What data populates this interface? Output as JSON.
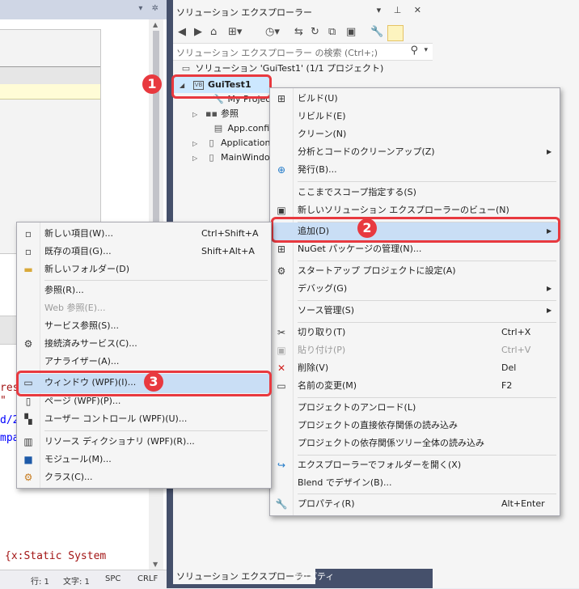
{
  "editor": {
    "code_lines": [
      "res",
      "\"",
      "d/2",
      "mpa",
      "{x:Static System"
    ],
    "status": {
      "line": "行: 1",
      "col": "文字: 1",
      "spc": "SPC",
      "crlf": "CRLF"
    }
  },
  "solution_explorer": {
    "title": "ソリューション エクスプローラー",
    "search_placeholder": "ソリューション エクスプローラー の検索 (Ctrl+;)",
    "tree": {
      "solution": "ソリューション 'GuiTest1' (1/1 プロジェクト)",
      "project": "GuiTest1",
      "project_badge": "VB",
      "items": [
        "My Project",
        "参照",
        "App.config",
        "Application.xaml",
        "MainWindow.xaml"
      ]
    },
    "tabs": {
      "explorer": "ソリューション エクスプローラー",
      "properties": "プロパティ"
    }
  },
  "project_menu": {
    "items": {
      "build": "ビルド(U)",
      "rebuild": "リビルド(E)",
      "clean": "クリーン(N)",
      "analyze": "分析とコードのクリーンアップ(Z)",
      "publish": "発行(B)...",
      "scope": "ここまでスコープ指定する(S)",
      "new_view": "新しいソリューション エクスプローラーのビュー(N)",
      "add": "追加(D)",
      "nuget": "NuGet パッケージの管理(N)...",
      "startup": "スタートアップ プロジェクトに設定(A)",
      "debug": "デバッグ(G)",
      "source_control": "ソース管理(S)",
      "cut": "切り取り(T)",
      "paste": "貼り付け(P)",
      "delete": "削除(V)",
      "rename": "名前の変更(M)",
      "unload": "プロジェクトのアンロード(L)",
      "load_direct": "プロジェクトの直接依存関係の読み込み",
      "load_tree": "プロジェクトの依存関係ツリー全体の読み込み",
      "open_folder": "エクスプローラーでフォルダーを開く(X)",
      "blend": "Blend でデザイン(B)...",
      "properties": "プロパティ(R)"
    },
    "shortcuts": {
      "cut": "Ctrl+X",
      "paste": "Ctrl+V",
      "delete": "Del",
      "rename": "F2",
      "properties": "Alt+Enter"
    }
  },
  "add_menu": {
    "items": {
      "new_item": "新しい項目(W)...",
      "existing_item": "既存の項目(G)...",
      "new_folder": "新しいフォルダー(D)",
      "reference": "参照(R)...",
      "web_reference": "Web 参照(E)...",
      "service_reference": "サービス参照(S)...",
      "connected_service": "接続済みサービス(C)...",
      "analyzer": "アナライザー(A)...",
      "window": "ウィンドウ (WPF)(I)...",
      "page": "ページ (WPF)(P)...",
      "user_control": "ユーザー コントロール (WPF)(U)...",
      "resource_dictionary": "リソース ディクショナリ (WPF)(R)...",
      "module": "モジュール(M)...",
      "class": "クラス(C)..."
    },
    "shortcuts": {
      "new_item": "Ctrl+Shift+A",
      "existing_item": "Shift+Alt+A"
    }
  },
  "callouts": [
    "1",
    "2",
    "3"
  ],
  "colors": {
    "callout": "#e8393f",
    "highlight": "#c9def5",
    "panel_border": "#45506b"
  }
}
